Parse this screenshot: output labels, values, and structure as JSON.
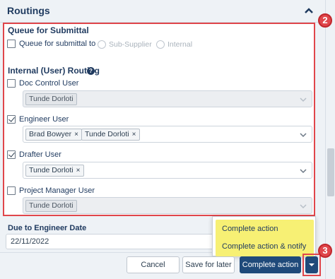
{
  "header": {
    "title": "Routings"
  },
  "queue": {
    "section_title": "Queue for Submittal",
    "checkbox_label": "Queue for submittal to",
    "options": [
      "Sub-Supplier",
      "Internal"
    ]
  },
  "internal_routing": {
    "section_title": "Internal (User) Routing",
    "help_glyph": "?",
    "groups": [
      {
        "label": "Doc Control User",
        "checked": false,
        "chips": [
          "Tunde Dorloti"
        ],
        "disabled": true
      },
      {
        "label": "Engineer User",
        "checked": true,
        "chips": [
          "Brad Bowyer",
          "Tunde Dorloti"
        ],
        "disabled": false
      },
      {
        "label": "Drafter User",
        "checked": true,
        "chips": [
          "Tunde Dorloti"
        ],
        "disabled": false
      },
      {
        "label": "Project Manager User",
        "checked": false,
        "chips": [
          "Tunde Dorloti"
        ],
        "disabled": true
      }
    ]
  },
  "due_date": {
    "label": "Due to Engineer Date",
    "value": "22/11/2022"
  },
  "dropdown": {
    "items": [
      "Complete action",
      "Complete action & notify"
    ],
    "highlight_color": "#f7f074"
  },
  "footer": {
    "cancel_label": "Cancel",
    "save_label": "Save for later",
    "complete_label": "Complete action"
  },
  "badges": {
    "b2": "2",
    "b3": "3"
  },
  "colors": {
    "accent": "#1f4a7a",
    "callout": "#e0464b"
  }
}
